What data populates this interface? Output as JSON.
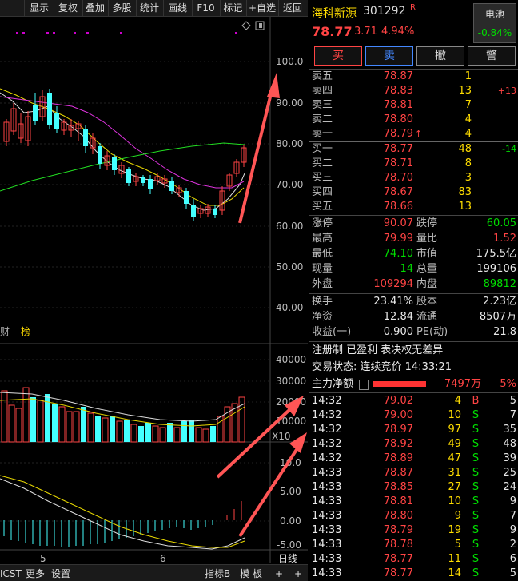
{
  "toolbar": {
    "items": [
      "显示",
      "复权",
      "叠加",
      "多股",
      "统计",
      "画线",
      "F10",
      "标记",
      "+自选",
      "返回"
    ]
  },
  "chart": {
    "price_axis": [
      "100.0",
      "90.00",
      "80.00",
      "70.00",
      "60.00",
      "50.00",
      "40.00"
    ],
    "volume_axis": [
      "40000",
      "30000",
      "20000",
      "10000",
      "X10"
    ],
    "macd_axis": [
      "10.0",
      "5.00",
      "0.00",
      "-5.00"
    ],
    "date_labels": [
      "5",
      "6"
    ],
    "mini_labels": [
      "财",
      "榜"
    ],
    "period_label": "日线"
  },
  "bottombar": {
    "left_items": [
      "ICST",
      "更多",
      "设置"
    ],
    "right_items": [
      "指标B",
      "模",
      "板",
      "+",
      "+"
    ]
  },
  "stock": {
    "name": "海科新源",
    "code": "301292",
    "badge": "R",
    "price": "78.77",
    "change": "3.71",
    "change_pct": "4.94%",
    "sector_name": "电池",
    "sector_change": "-0.84%"
  },
  "buttons": {
    "buy": "买",
    "sell": "卖",
    "cancel": "撤",
    "alert": "警"
  },
  "asks": [
    {
      "label": "卖五",
      "price": "78.87",
      "vol": "1",
      "delta": ""
    },
    {
      "label": "卖四",
      "price": "78.83",
      "vol": "13",
      "delta": "+13"
    },
    {
      "label": "卖三",
      "price": "78.81",
      "vol": "7",
      "delta": ""
    },
    {
      "label": "卖二",
      "price": "78.80",
      "vol": "4",
      "delta": ""
    },
    {
      "label": "卖一",
      "price": "78.79",
      "vol": "4",
      "delta": ""
    }
  ],
  "bids": [
    {
      "label": "买一",
      "price": "78.77",
      "vol": "48",
      "delta": "-14"
    },
    {
      "label": "买二",
      "price": "78.71",
      "vol": "8",
      "delta": ""
    },
    {
      "label": "买三",
      "price": "78.70",
      "vol": "3",
      "delta": ""
    },
    {
      "label": "买四",
      "price": "78.67",
      "vol": "83",
      "delta": ""
    },
    {
      "label": "买五",
      "price": "78.66",
      "vol": "13",
      "delta": ""
    }
  ],
  "stats1": [
    {
      "l1": "涨停",
      "v1": "90.07",
      "l2": "跌停",
      "v2": "60.05"
    },
    {
      "l1": "最高",
      "v1": "79.99",
      "l2": "量比",
      "v2": "1.52"
    },
    {
      "l1": "最低",
      "v1": "74.10",
      "l2": "市值",
      "v2": "175.5亿"
    },
    {
      "l1": "现量",
      "v1": "14",
      "l2": "总量",
      "v2": "199106"
    },
    {
      "l1": "外盘",
      "v1": "109294",
      "l2": "内盘",
      "v2": "89812"
    }
  ],
  "stats2": [
    {
      "l1": "换手",
      "v1": "23.41%",
      "l2": "股本",
      "v2": "2.23亿"
    },
    {
      "l1": "净资",
      "v1": "12.84",
      "l2": "流通",
      "v2": "8507万"
    },
    {
      "l1": "收益(一)",
      "v1": "0.900",
      "l2": "PE(动)",
      "v2": "21.8"
    }
  ],
  "info": {
    "tags": "注册制 已盈利 表决权无差异",
    "status": "交易状态: 连续竞价 14:33:21"
  },
  "mainflow": {
    "label": "主力净额",
    "amount": "7497万",
    "pct": "5%"
  },
  "ticks": [
    {
      "time": "14:32",
      "price": "79.02",
      "vol": "4",
      "bs": "B",
      "n": "5"
    },
    {
      "time": "14:32",
      "price": "79.00",
      "vol": "10",
      "bs": "S",
      "n": "7"
    },
    {
      "time": "14:32",
      "price": "78.97",
      "vol": "97",
      "bs": "S",
      "n": "35"
    },
    {
      "time": "14:32",
      "price": "78.92",
      "vol": "49",
      "bs": "S",
      "n": "48"
    },
    {
      "time": "14:32",
      "price": "78.89",
      "vol": "47",
      "bs": "S",
      "n": "39"
    },
    {
      "time": "14:33",
      "price": "78.87",
      "vol": "31",
      "bs": "S",
      "n": "25"
    },
    {
      "time": "14:33",
      "price": "78.85",
      "vol": "27",
      "bs": "S",
      "n": "24"
    },
    {
      "time": "14:33",
      "price": "78.81",
      "vol": "10",
      "bs": "S",
      "n": "9"
    },
    {
      "time": "14:33",
      "price": "78.80",
      "vol": "9",
      "bs": "S",
      "n": "7"
    },
    {
      "time": "14:33",
      "price": "78.79",
      "vol": "19",
      "bs": "S",
      "n": "9"
    },
    {
      "time": "14:33",
      "price": "78.78",
      "vol": "5",
      "bs": "S",
      "n": "2"
    },
    {
      "time": "14:33",
      "price": "78.77",
      "vol": "11",
      "bs": "S",
      "n": "6"
    },
    {
      "time": "14:33",
      "price": "78.77",
      "vol": "14",
      "bs": "S",
      "n": "5"
    }
  ],
  "colors": {
    "up": "#ff4444",
    "down": "#00dd00",
    "accent": "#ffdd00"
  }
}
